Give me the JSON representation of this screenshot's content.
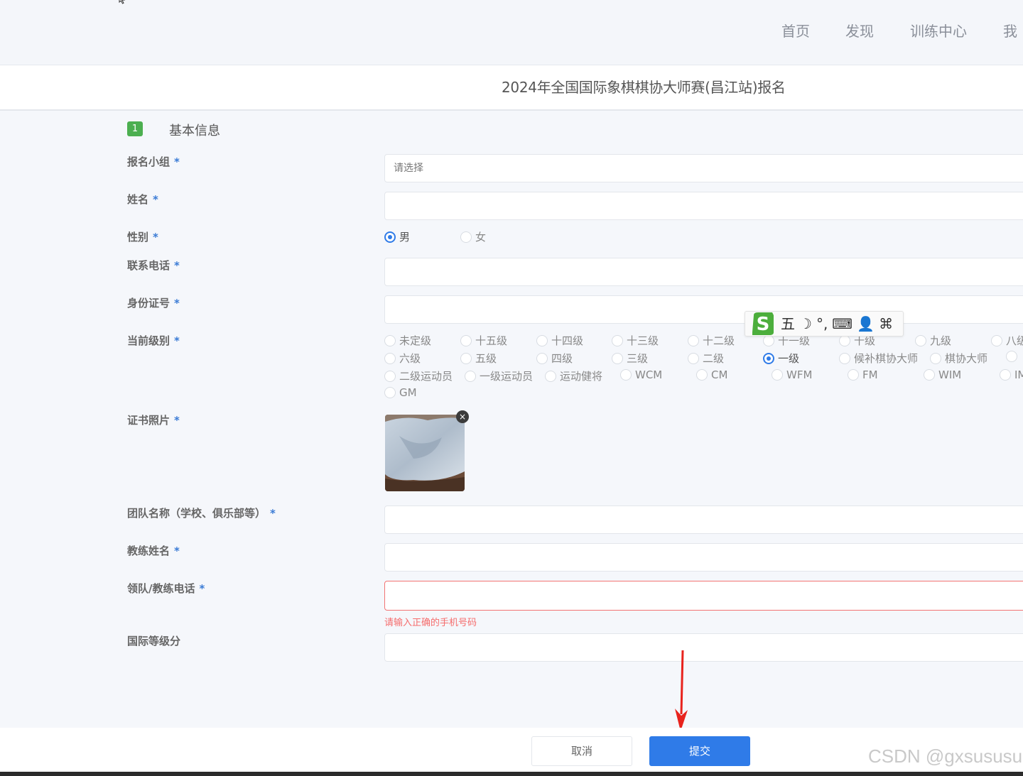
{
  "nav": {
    "items": [
      "首页",
      "发现",
      "训练中心",
      "我"
    ]
  },
  "page_title": "2024年全国国际象棋棋协大师赛(昌江站)报名",
  "section": {
    "badge": "1",
    "title": "基本信息"
  },
  "form": {
    "required_mark": "*",
    "group": {
      "label": "报名小组",
      "placeholder": "请选择"
    },
    "name": {
      "label": "姓名",
      "value": ""
    },
    "gender": {
      "label": "性别",
      "options": [
        "男",
        "女"
      ],
      "selected": "男"
    },
    "phone": {
      "label": "联系电话",
      "value": ""
    },
    "id_number": {
      "label": "身份证号",
      "value": ""
    },
    "level": {
      "label": "当前级别",
      "options": [
        "未定级",
        "十五级",
        "十四级",
        "十三级",
        "十二级",
        "十一级",
        "十级",
        "九级",
        "八级",
        "六级",
        "五级",
        "四级",
        "三级",
        "二级",
        "一级",
        "候补棋协大师",
        "棋协大师",
        "二级运动员",
        "一级运动员",
        "运动健将",
        "WCM",
        "CM",
        "WFM",
        "FM",
        "WIM",
        "IM",
        "GM"
      ],
      "selected": "一级"
    },
    "certificate_photo": {
      "label": "证书照片",
      "close": "×"
    },
    "team": {
      "label": "团队名称（学校、俱乐部等）",
      "value": ""
    },
    "coach_name": {
      "label": "教练姓名",
      "value": ""
    },
    "coach_phone": {
      "label": "领队/教练电话",
      "value": "",
      "error": "请输入正确的手机号码"
    },
    "intl_rating": {
      "label": "国际等级分",
      "value": ""
    }
  },
  "ime_toolbar": {
    "items": [
      "五",
      "☽",
      "°,",
      "⌨",
      "👤",
      "⌘"
    ]
  },
  "buttons": {
    "cancel": "取消",
    "submit": "提交"
  },
  "watermark": "CSDN @gxsususu",
  "colors": {
    "primary": "#2f7be8",
    "error": "#f56c6c",
    "badge": "#4caf50",
    "arrow": "#e8231d"
  }
}
